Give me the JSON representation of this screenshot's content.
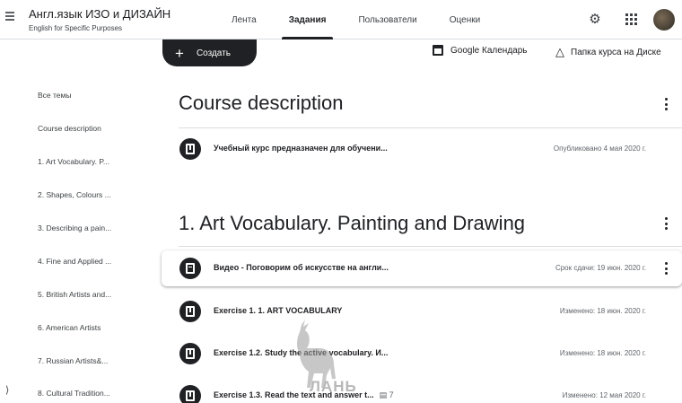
{
  "header": {
    "course_title": "Англ.язык ИЗО и ДИЗАЙН",
    "course_subtitle": "English for Specific Purposes",
    "tabs": [
      {
        "label": "Лента",
        "active": false
      },
      {
        "label": "Задания",
        "active": true
      },
      {
        "label": "Пользователи",
        "active": false
      },
      {
        "label": "Оценки",
        "active": false
      }
    ],
    "icons": [
      "menu-icon",
      "gear-icon",
      "apps-icon",
      "avatar"
    ]
  },
  "toolbar": {
    "create_label": "Создать",
    "calendar_link": "Google Календарь",
    "drive_link": "Папка курса на Диске"
  },
  "sidebar": {
    "items": [
      {
        "label": "Все темы"
      },
      {
        "label": "Course description"
      },
      {
        "label": "1. Art Vocabulary. P..."
      },
      {
        "label": "2. Shapes, Colours ..."
      },
      {
        "label": "3. Describing a pain..."
      },
      {
        "label": "4. Fine and Applied ..."
      },
      {
        "label": "5. British Artists and..."
      },
      {
        "label": "6. American Artists"
      },
      {
        "label": "7. Russian Artists&..."
      },
      {
        "label": "8. Cultural Tradition..."
      }
    ]
  },
  "topics": [
    {
      "title": "Course description",
      "items": [
        {
          "title": "Учебный курс предназначен для обучени...",
          "meta": "Опубликовано 4 мая 2020 г.",
          "icon": "material-icon"
        }
      ]
    },
    {
      "title": "1. Art Vocabulary. Painting and Drawing",
      "items": [
        {
          "title": "Видео - Поговорим об искусстве на англи...",
          "meta": "Срок сдачи: 19 июн. 2020 г.",
          "icon": "assignment-icon"
        },
        {
          "title": "Exercise 1. 1. ART VOCABULARY",
          "meta": "Изменено: 18 июн. 2020 г.",
          "icon": "material-icon"
        },
        {
          "title": "Exercise 1.2. Study the active vocabulary. И...",
          "meta": "Изменено: 18 июн. 2020 г.",
          "icon": "material-icon"
        },
        {
          "title": "Exercise 1.3. Read the text and answer t...",
          "extra": "7",
          "meta": "Изменено: 12 мая 2020 г.",
          "icon": "material-icon"
        }
      ]
    }
  ],
  "watermark": {
    "text": "ЛАНЬ"
  },
  "colors": {
    "accent": "#202124",
    "divider": "#dadce0",
    "muted": "#5f6368"
  }
}
